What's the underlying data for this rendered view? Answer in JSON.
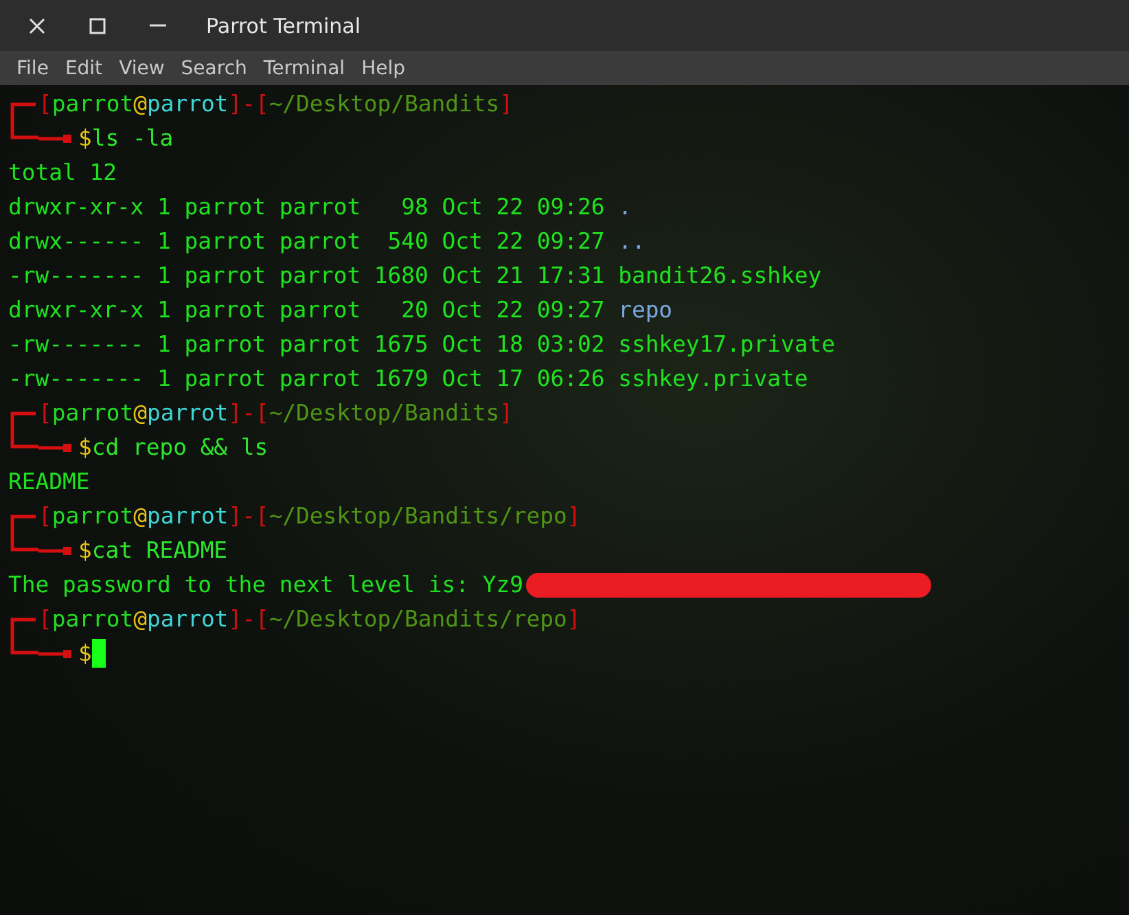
{
  "window": {
    "title": "Parrot Terminal"
  },
  "menu": [
    "File",
    "Edit",
    "View",
    "Search",
    "Terminal",
    "Help"
  ],
  "lines": [
    {
      "kind": "prompt",
      "open": "[",
      "user": "parrot",
      "at": "@",
      "host": "parrot",
      "close": "]",
      "sep": "-",
      "path_open": "[",
      "path": "~/Desktop/Bandits",
      "path_close": "]",
      "symbol": "$",
      "command": "ls -la"
    },
    {
      "kind": "output",
      "text": "total 12"
    },
    {
      "kind": "listing",
      "info": "drwxr-xr-x 1 parrot parrot   98 Oct 22 09:26",
      "name": ".",
      "directory": true
    },
    {
      "kind": "listing",
      "info": "drwx------ 1 parrot parrot  540 Oct 22 09:27",
      "name": "..",
      "directory": true
    },
    {
      "kind": "listing",
      "info": "-rw------- 1 parrot parrot 1680 Oct 21 17:31",
      "name": "bandit26.sshkey",
      "directory": false
    },
    {
      "kind": "listing",
      "info": "drwxr-xr-x 1 parrot parrot   20 Oct 22 09:27",
      "name": "repo",
      "directory": true
    },
    {
      "kind": "listing",
      "info": "-rw------- 1 parrot parrot 1675 Oct 18 03:02",
      "name": "sshkey17.private",
      "directory": false
    },
    {
      "kind": "listing",
      "info": "-rw------- 1 parrot parrot 1679 Oct 17 06:26",
      "name": "sshkey.private",
      "directory": false
    },
    {
      "kind": "prompt",
      "open": "[",
      "user": "parrot",
      "at": "@",
      "host": "parrot",
      "close": "]",
      "sep": "-",
      "path_open": "[",
      "path": "~/Desktop/Bandits",
      "path_close": "]",
      "symbol": "$",
      "command": "cd repo && ls"
    },
    {
      "kind": "output",
      "text": "README"
    },
    {
      "kind": "prompt",
      "open": "[",
      "user": "parrot",
      "at": "@",
      "host": "parrot",
      "close": "]",
      "sep": "-",
      "path_open": "[",
      "path": "~/Desktop/Bandits/repo",
      "path_close": "]",
      "symbol": "$",
      "command": "cat README"
    },
    {
      "kind": "redacted",
      "text": "The password to the next level is: Yz9"
    },
    {
      "kind": "prompt",
      "open": "[",
      "user": "parrot",
      "at": "@",
      "host": "parrot",
      "close": "]",
      "sep": "-",
      "path_open": "[",
      "path": "~/Desktop/Bandits/repo",
      "path_close": "]",
      "symbol": "$",
      "cursor": true
    }
  ]
}
